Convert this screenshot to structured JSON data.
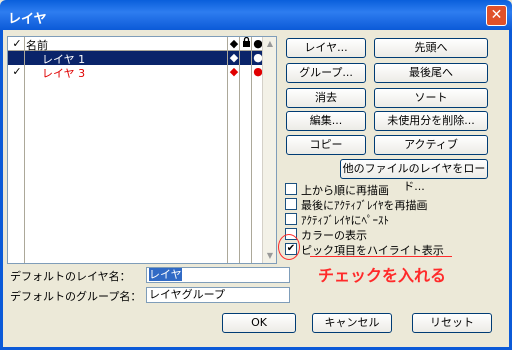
{
  "window": {
    "title": "レイヤ"
  },
  "list": {
    "header": {
      "check": "✓",
      "name": "名前",
      "col_a": "◆",
      "col_c": "●"
    },
    "rows": [
      {
        "check": "",
        "name": "レイヤ 1",
        "col_a": "◆",
        "col_c": "●"
      },
      {
        "check": "✓",
        "name": "レイヤ 3",
        "col_a": "◆",
        "col_c": "●"
      }
    ]
  },
  "buttons": {
    "layer": "レイヤ...",
    "first": "先頭へ",
    "group": "グループ...",
    "last": "最後尾へ",
    "delete": "消去",
    "sort": "ソート",
    "edit": "編集...",
    "delete_unused": "未使用分を削除...",
    "copy": "コピー",
    "active": "アクティブ",
    "load_other": "他のファイルのレイヤをロード...",
    "ok": "OK",
    "cancel": "キャンセル",
    "reset": "リセット"
  },
  "options": [
    {
      "label": "上から順に再描画",
      "checked": false
    },
    {
      "label": "最後にｱｸﾃｨﾌﾞﾚｲﾔを再描画",
      "checked": false
    },
    {
      "label": "ｱｸﾃｨﾌﾞﾚｲﾔにﾍﾟｰｽﾄ",
      "checked": false
    },
    {
      "label": "カラーの表示",
      "checked": false
    },
    {
      "label": "ピック項目をハイライト表示",
      "checked": true,
      "mark": "✔"
    }
  ],
  "fields": {
    "default_layer_label": "デフォルトのレイヤ名：",
    "default_layer_value": "レイヤ",
    "default_group_label": "デフォルトのグループ名：",
    "default_group_value": "レイヤグループ"
  },
  "annotation": {
    "text": "チェックを入れる",
    "color": "#FF2A2A"
  },
  "colors": {
    "titlebar": "#0A5FDB",
    "selection": "#0A246A",
    "red": "#E00000"
  }
}
